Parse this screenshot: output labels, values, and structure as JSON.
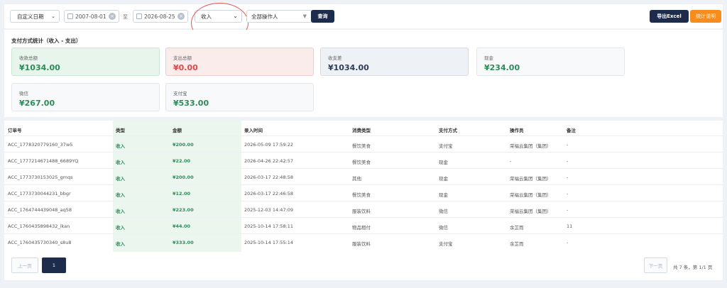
{
  "filters": {
    "date_type": "自定义日期",
    "date_start": "2007-08-01",
    "to": "至",
    "date_end": "2026-08-25",
    "type": "收入",
    "operator": "全部操作人",
    "query_label": "查询",
    "export_label": "导出Excel",
    "help_label": "统计说明"
  },
  "stats": {
    "title": "支付方式统计（收入 - 支出）",
    "cards": [
      {
        "label": "收款总额",
        "value": "¥1034.00"
      },
      {
        "label": "支出总额",
        "value": "¥0.00"
      },
      {
        "label": "收支差",
        "value": "¥1034.00"
      },
      {
        "label": "现金",
        "value": "¥234.00"
      },
      {
        "label": "微信",
        "value": "¥267.00"
      },
      {
        "label": "支付宝",
        "value": "¥533.00"
      }
    ]
  },
  "table": {
    "columns": [
      "订单号",
      "类型",
      "金额",
      "录入时间",
      "消费类型",
      "支付方式",
      "操作员",
      "备注"
    ],
    "rows": [
      [
        "ACC_1778320779160_37w5",
        "收入",
        "¥200.00",
        "2026-05-09 17:59:22",
        "餐饮美食",
        "支付宝",
        "荣福云集团（集团）",
        "-"
      ],
      [
        "ACC_1777214671488_6689YQ",
        "收入",
        "¥22.00",
        "2026-04-26 22:42:57",
        "餐饮美食",
        "现金",
        "-",
        "-"
      ],
      [
        "ACC_1773730153025_gmqs",
        "收入",
        "¥200.00",
        "2026-03-17 22:48:58",
        "其他",
        "现金",
        "荣福云集团（集团）",
        "-"
      ],
      [
        "ACC_1773730044231_bbgr",
        "收入",
        "¥12.00",
        "2026-03-17 22:46:58",
        "餐饮美食",
        "现金",
        "荣福云集团（集团）",
        "-"
      ],
      [
        "ACC_1764744439048_aq58",
        "收入",
        "¥223.00",
        "2025-12-03 14:47:09",
        "服装饮料",
        "微信",
        "荣福云集团（集团）",
        "-"
      ],
      [
        "ACC_1760435898432_ikan",
        "收入",
        "¥44.00",
        "2025-10-14 17:58:11",
        "物品租付",
        "微信",
        "余芷而",
        "11"
      ],
      [
        "ACC_1760435730340_s8u8",
        "收入",
        "¥333.00",
        "2025-10-14 17:55:14",
        "服装饮料",
        "支付宝",
        "余芷而",
        "-"
      ]
    ]
  },
  "pager": {
    "prev": "上一页",
    "current": "1",
    "next": "下一页",
    "summary": "共 7 条，第 1/1 页"
  }
}
